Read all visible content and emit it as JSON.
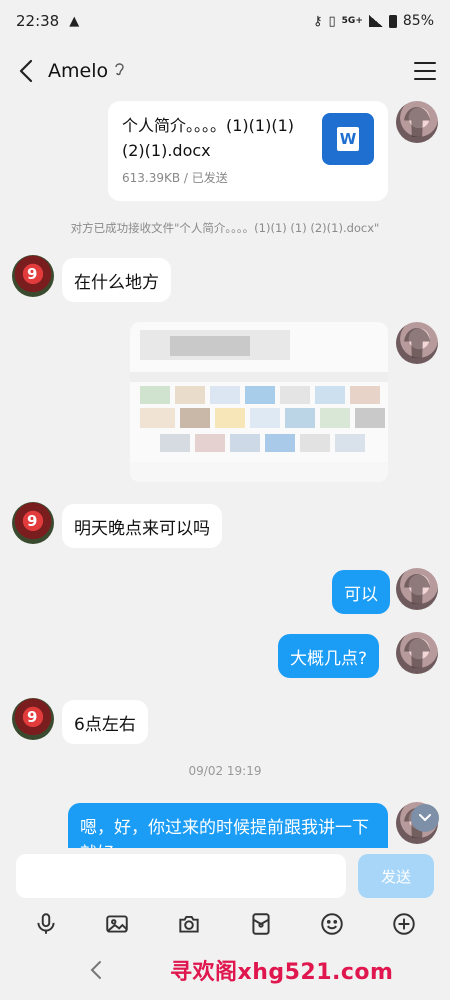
{
  "status_bar": {
    "time": "22:38",
    "network": "5G+",
    "battery": "85%"
  },
  "header": {
    "title": "Amelo"
  },
  "messages": {
    "file": {
      "name": "个人简介。。。。(1)(1)(1) (2)(1).docx",
      "meta": "613.39KB / 已发送",
      "icon_letter": "W"
    },
    "system_note": "对方已成功接收文件\"个人简介。。。。(1)(1) (1) (2)(1).docx\"",
    "m1": "在什么地方",
    "m2": "明天晚点来可以吗",
    "m3": "可以",
    "m4": "大概几点?",
    "m5": "6点左右",
    "timestamp": "09/02 19:19",
    "m6": "嗯，好，你过来的时候提前跟我讲一下就好"
  },
  "composer": {
    "placeholder": "",
    "send_label": "发送"
  },
  "watermark": "寻欢阁xhg521.com",
  "colors": {
    "outgoing_bubble": "#1b9cf5",
    "send_disabled": "#a7d6f8",
    "background": "#f1f1f1"
  }
}
